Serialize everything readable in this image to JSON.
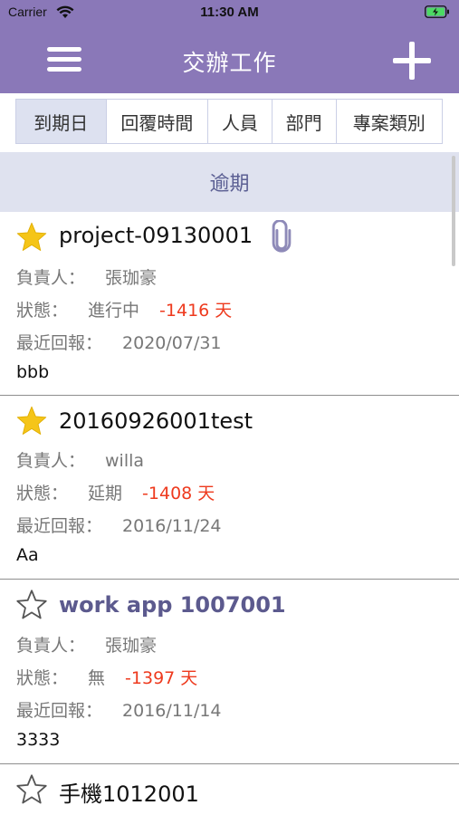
{
  "status_bar": {
    "carrier": "Carrier",
    "time": "11:30 AM"
  },
  "nav": {
    "title": "交辦工作"
  },
  "tabs": [
    {
      "label": "到期日",
      "active": true
    },
    {
      "label": "回覆時間",
      "active": false
    },
    {
      "label": "人員",
      "active": false
    },
    {
      "label": "部門",
      "active": false
    },
    {
      "label": "專案類別",
      "active": false
    }
  ],
  "section": {
    "title": "逾期"
  },
  "labels": {
    "owner": "負責人：",
    "status": "狀態：",
    "last_report": "最近回報："
  },
  "tasks": [
    {
      "title": "project-09130001",
      "starred": true,
      "attachment": true,
      "owner": "張珈豪",
      "status": "進行中",
      "days": "-1416 天",
      "last_report": "2020/07/31",
      "note": "bbb"
    },
    {
      "title": "20160926001test",
      "starred": true,
      "attachment": false,
      "owner": "willa",
      "status": "延期",
      "days": "-1408 天",
      "last_report": "2016/11/24",
      "note": "Aa"
    },
    {
      "title": "work app 1007001",
      "starred": false,
      "attachment": false,
      "owner": "張珈豪",
      "status": "無",
      "days": "-1397 天",
      "last_report": "2016/11/14",
      "note": "3333"
    },
    {
      "title": "手機1012001",
      "starred": false,
      "attachment": false
    }
  ],
  "colors": {
    "nav_bar": "#8a78b8",
    "star_filled": "#f5c518",
    "overdue_days": "#ee3a1e",
    "section_bg": "#dfe2ef"
  }
}
